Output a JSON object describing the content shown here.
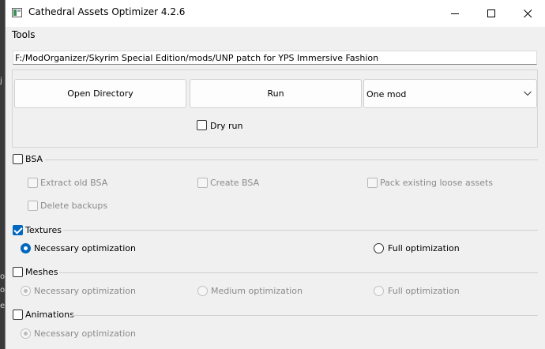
{
  "window": {
    "title": "Cathedral Assets Optimizer 4.2.6"
  },
  "menu": {
    "tools_label": "Tools"
  },
  "path": {
    "value": "F:/ModOrganizer/Skyrim Special Edition/mods/UNP patch for YPS Immersive Fashion"
  },
  "actions": {
    "open_directory_label": "Open Directory",
    "run_label": "Run",
    "mode_selected": "One mod",
    "dry_run_label": "Dry run"
  },
  "bsa": {
    "label": "BSA",
    "extract_old_label": "Extract old BSA",
    "create_label": "Create BSA",
    "pack_loose_label": "Pack existing loose assets",
    "delete_backups_label": "Delete backups"
  },
  "textures": {
    "label": "Textures",
    "necessary_label": "Necessary optimization",
    "full_label": "Full optimization"
  },
  "meshes": {
    "label": "Meshes",
    "necessary_label": "Necessary optimization",
    "medium_label": "Medium optimization",
    "full_label": "Full optimization"
  },
  "animations": {
    "label": "Animations",
    "necessary_label": "Necessary optimization"
  },
  "background_fragments": [
    "j",
    "o",
    "ol",
    "e"
  ],
  "colors": {
    "accent": "#0067c0",
    "window_bg": "#f0f0f0"
  }
}
